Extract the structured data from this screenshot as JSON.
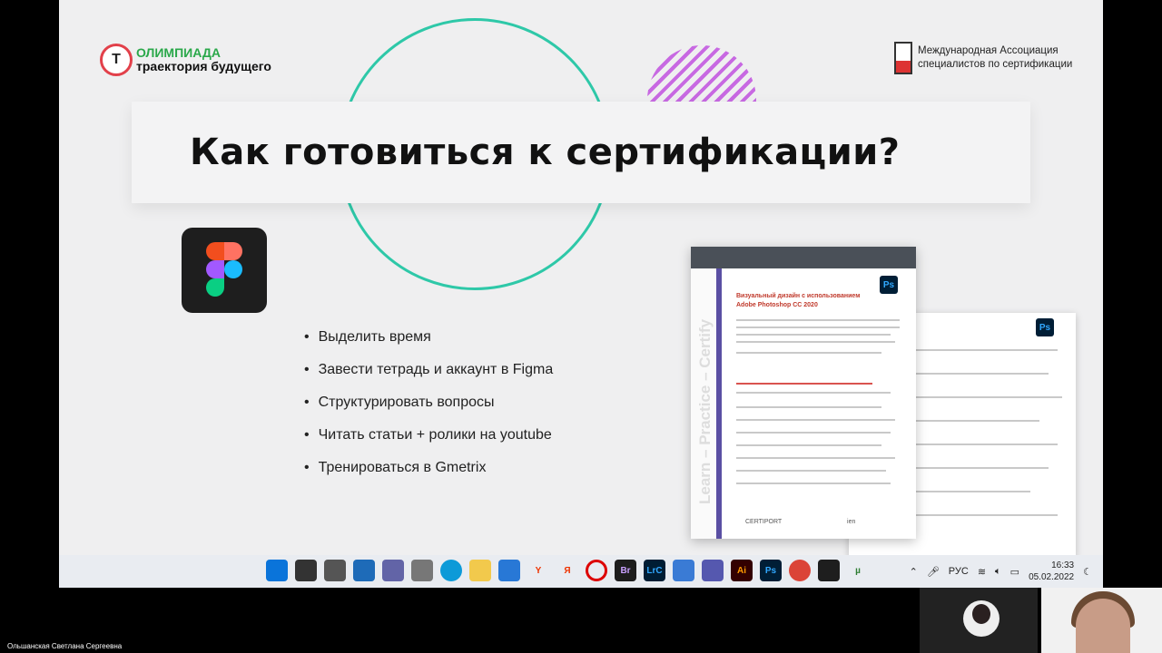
{
  "slide": {
    "title": "Как готовиться к сертификации?",
    "logo_left": {
      "line1": "ОЛИМПИАДА",
      "line2": "траектория будущего"
    },
    "logo_right": {
      "line1": "Международная Ассоциация",
      "line2": "специалистов по сертификации"
    },
    "bullets": [
      "Выделить время",
      "Завести тетрадь и аккаунт в Figma",
      "Структурировать вопросы",
      "Читать статьи + ролики на youtube",
      "Тренироваться в Gmetrix"
    ],
    "doc": {
      "title_line1": "Визуальный дизайн с использованием",
      "title_line2": "Adobe Photoshop CC 2020",
      "side_text": "Learn – Practice – Certify",
      "ps_label": "Ps",
      "footer_left": "CERTIPORT",
      "footer_right": "ien"
    }
  },
  "taskbar": {
    "apps": [
      "windows",
      "search",
      "task-view",
      "widgets",
      "chat",
      "calculator",
      "edge",
      "explorer",
      "store",
      "yandex",
      "yandex-browser",
      "opera",
      "bridge",
      "lightroom-classic",
      "notes",
      "teams",
      "illustrator",
      "photoshop",
      "chrome",
      "figma",
      "torrent"
    ],
    "app_labels": {
      "bridge": "Br",
      "lightroom-classic": "LrC",
      "illustrator": "Ai",
      "photoshop": "Ps"
    },
    "language": "РУС",
    "time": "16:33",
    "date": "05.02.2022"
  },
  "participants": {
    "speaker_name": "Ольшанская Светлана Сергеевна"
  }
}
